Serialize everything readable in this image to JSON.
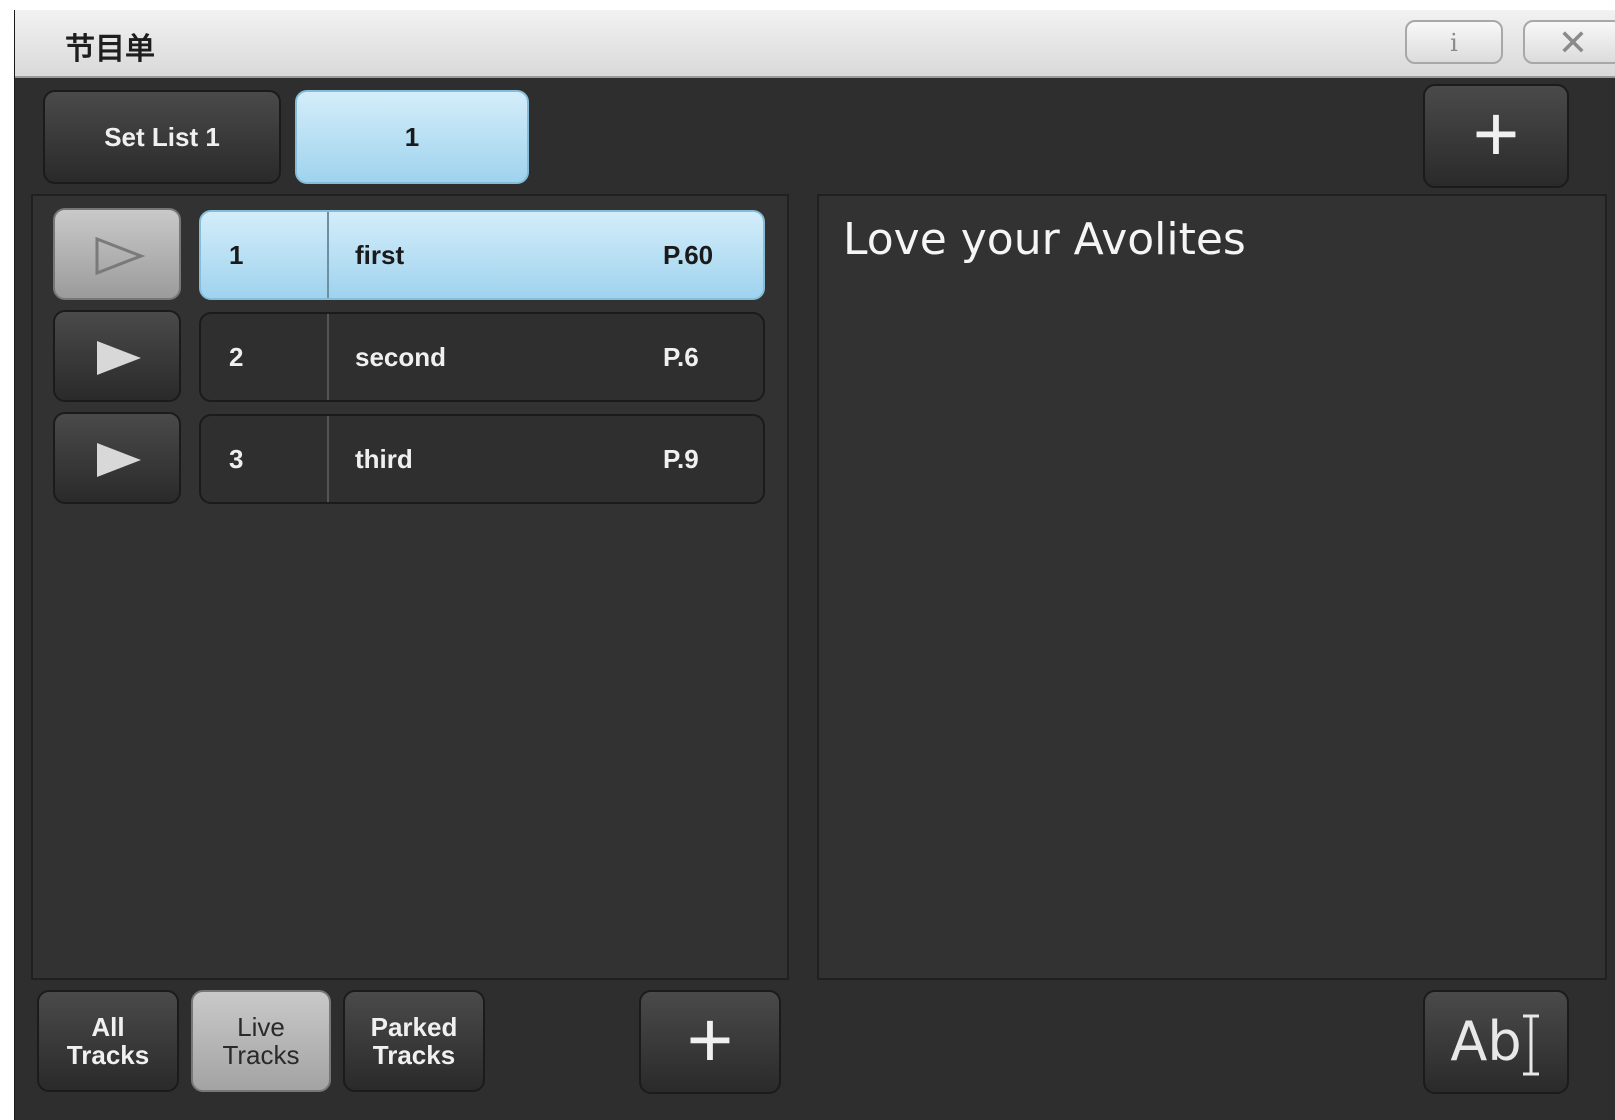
{
  "window": {
    "title": "节目单",
    "info_label": "i",
    "close_label": "✕"
  },
  "tabs": {
    "setlist_label": "Set List 1",
    "selected_tab_label": "1",
    "add_label": "+"
  },
  "tracks": [
    {
      "number": "1",
      "name": "first",
      "page": "P.60",
      "selected": true
    },
    {
      "number": "2",
      "name": "second",
      "page": "P.6",
      "selected": false
    },
    {
      "number": "3",
      "name": "third",
      "page": "P.9",
      "selected": false
    }
  ],
  "notes": {
    "text": "Love your Avolites"
  },
  "filters": {
    "all": "All\nTracks",
    "live": "Live\nTracks",
    "parked": "Parked\nTracks",
    "active": "live"
  },
  "toolbar": {
    "add_track_label": "+",
    "edit_text_label": "Ab"
  },
  "colors": {
    "selected_blue": "#a8d8f0",
    "background": "#2e2e2e"
  },
  "icons": {
    "play": "play-icon",
    "edit_text": "text-cursor-icon"
  }
}
